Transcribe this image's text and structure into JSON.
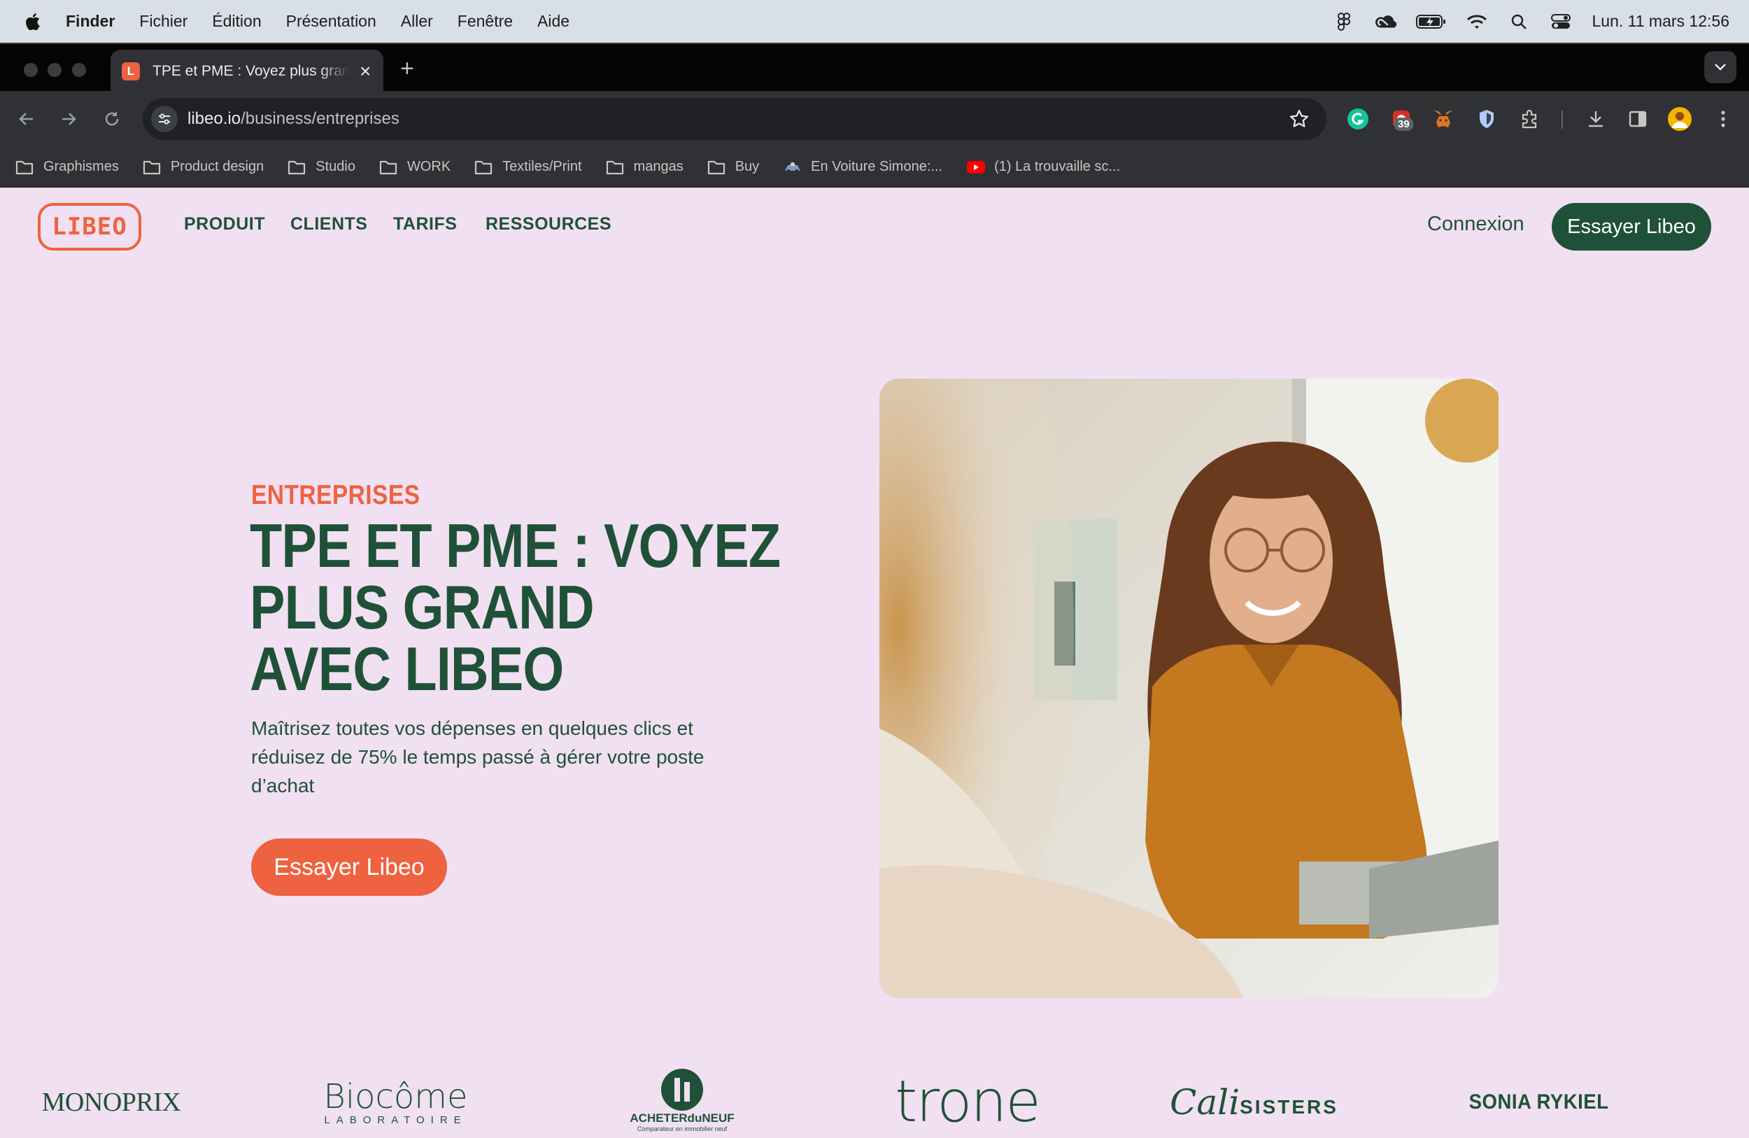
{
  "menubar": {
    "items": [
      "Finder",
      "Fichier",
      "Édition",
      "Présentation",
      "Aller",
      "Fenêtre",
      "Aide"
    ],
    "clock": "Lun. 11 mars  12:56",
    "status_icons": [
      "figma-icon",
      "creative-cloud-icon",
      "battery-icon",
      "wifi-icon",
      "search-icon",
      "control-center-icon"
    ]
  },
  "browser": {
    "tab_title": "TPE et PME : Voyez plus grand avec Libeo",
    "tab_favicon_letter": "L",
    "url_host": "libeo.io",
    "url_path": "/business/entreprises",
    "extension_badge": "39",
    "bookmarks": [
      {
        "label": "Graphismes",
        "icon": "folder-icon"
      },
      {
        "label": "Product design",
        "icon": "folder-icon"
      },
      {
        "label": "Studio",
        "icon": "folder-icon"
      },
      {
        "label": "WORK",
        "icon": "folder-icon"
      },
      {
        "label": "Textiles/Print",
        "icon": "folder-icon"
      },
      {
        "label": "mangas",
        "icon": "folder-icon"
      },
      {
        "label": "Buy",
        "icon": "folder-icon"
      },
      {
        "label": "En Voiture Simone:...",
        "icon": "car-favicon"
      },
      {
        "label": "(1) La trouvaille sc...",
        "icon": "youtube-icon"
      }
    ]
  },
  "site": {
    "logo": "LIBEO",
    "nav": [
      "PRODUIT",
      "CLIENTS",
      "TARIFS",
      "RESSOURCES"
    ],
    "login": "Connexion",
    "cta_top": "Essayer Libeo",
    "brand_colors": {
      "green": "#1f5138",
      "orange": "#ee6240",
      "background": "#f1e0f1"
    }
  },
  "hero": {
    "eyebrow": "ENTREPRISES",
    "headline": [
      "TPE ET PME : VOYEZ",
      "PLUS GRAND",
      "AVEC LIBEO"
    ],
    "lead": "Maîtrisez toutes vos dépenses en quelques clics et réduisez de 75% le temps passé à gérer votre poste d’achat",
    "cta": "Essayer Libeo"
  },
  "clients": {
    "monoprix": "MONOPRIX",
    "biocome_main": "Biocôme",
    "biocome_sub": "LABORATOIRE",
    "acheter_main": "ACHETERduNEUF",
    "acheter_sub": "Comparateur en immobilier neuf",
    "trone": "trone",
    "cali_script": "Cali",
    "cali_caps": "SISTERS",
    "sonia": "SONIA RYKIEL"
  }
}
